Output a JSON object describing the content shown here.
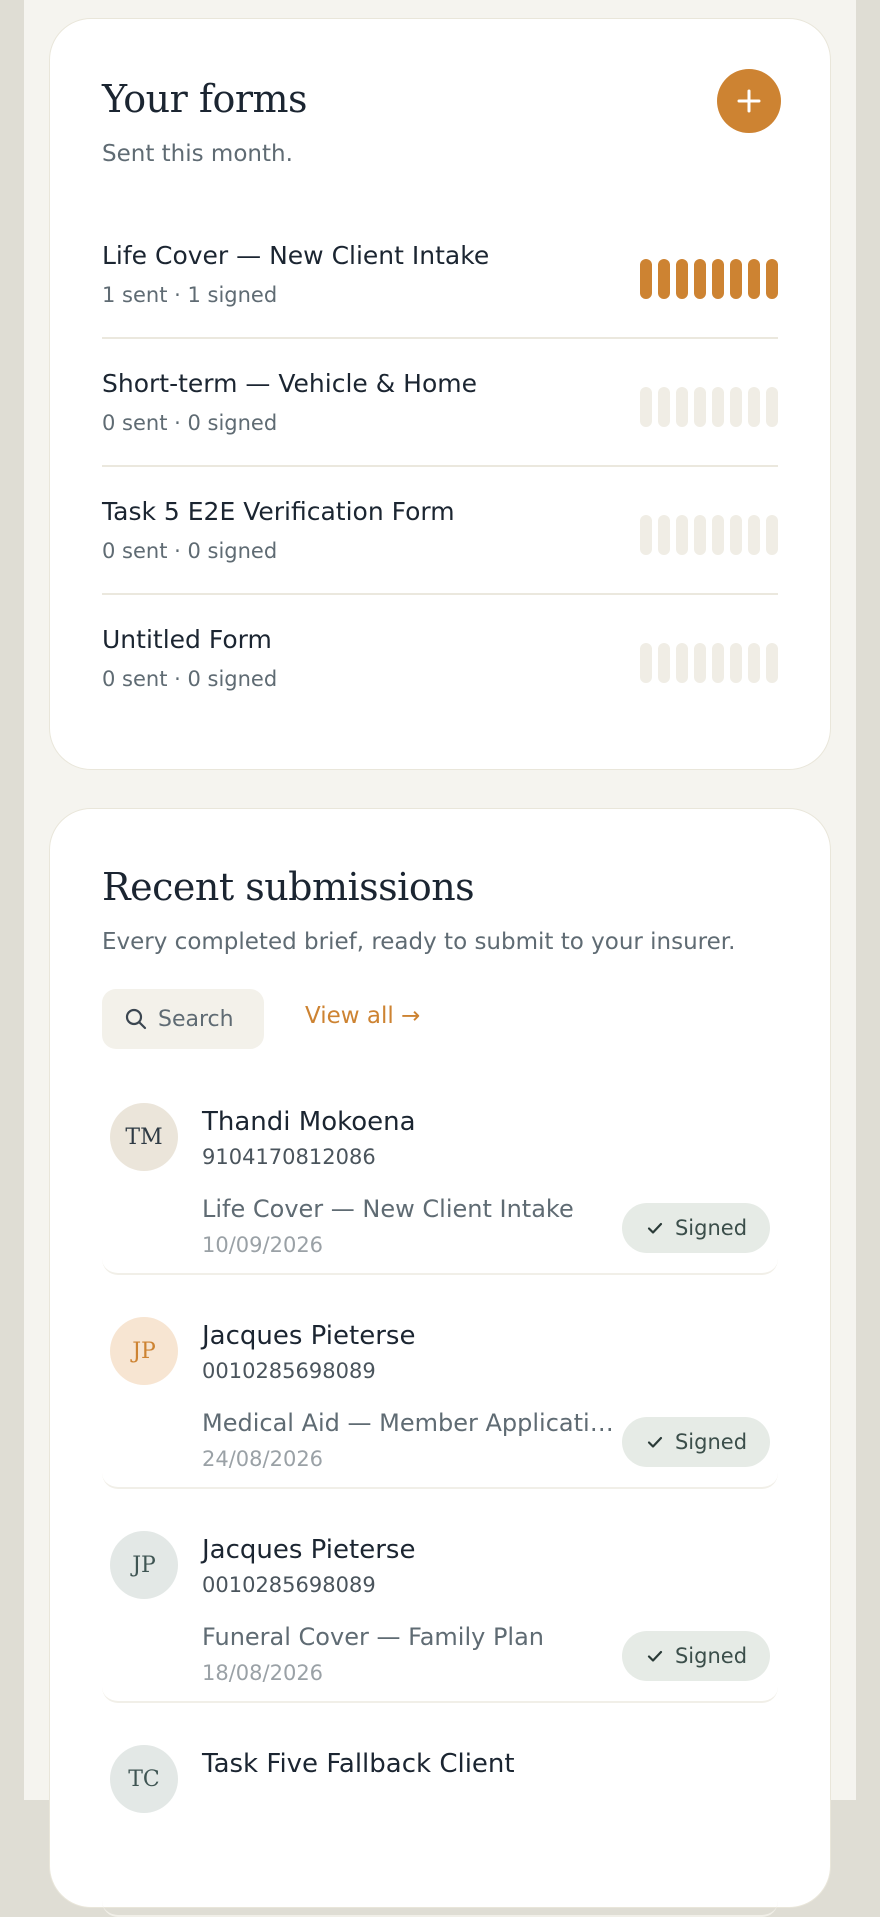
{
  "forms": {
    "title": "Your forms",
    "subtitle": "Sent this month.",
    "add_icon": "plus-icon",
    "items": [
      {
        "name": "Life Cover — New Client Intake",
        "stats": "1 sent · 1 signed",
        "progress_filled_bars": 8,
        "progress_total_bars": 8
      },
      {
        "name": "Short-term — Vehicle & Home",
        "stats": "0 sent · 0 signed",
        "progress_filled_bars": 0,
        "progress_total_bars": 8
      },
      {
        "name": "Task 5 E2E Verification Form",
        "stats": "0 sent · 0 signed",
        "progress_filled_bars": 0,
        "progress_total_bars": 8
      },
      {
        "name": "Untitled Form",
        "stats": "0 sent · 0 signed",
        "progress_filled_bars": 0,
        "progress_total_bars": 8
      }
    ]
  },
  "submissions": {
    "title": "Recent submissions",
    "subtitle": "Every completed brief, ready to submit to your insurer.",
    "search_label": "Search",
    "view_all": "View all →",
    "items": [
      {
        "initials": "TM",
        "name": "Thandi Mokoena",
        "id_number": "9104170812086",
        "form": "Life Cover — New Client Intake",
        "date": "10/09/2026",
        "status": "Signed",
        "avatar_bg": "#ebe5da",
        "avatar_fg": "#2e3a44"
      },
      {
        "initials": "JP",
        "name": "Jacques Pieterse",
        "id_number": "0010285698089",
        "form": "Medical Aid — Member Application",
        "date": "24/08/2026",
        "status": "Signed",
        "avatar_bg": "#f7e5d2",
        "avatar_fg": "#cd8332"
      },
      {
        "initials": "JP",
        "name": "Jacques Pieterse",
        "id_number": "0010285698089",
        "form": "Funeral Cover — Family Plan",
        "date": "18/08/2026",
        "status": "Signed",
        "avatar_bg": "#e3e8e6",
        "avatar_fg": "#3f5553"
      },
      {
        "initials": "TC",
        "name": "Task Five Fallback Client",
        "id_number": "",
        "form": "",
        "date": "",
        "status": "",
        "avatar_bg": "#e3e8e6",
        "avatar_fg": "#3f5553"
      }
    ]
  },
  "colors": {
    "accent": "#cd8332",
    "bar_empty": "#f0ede5",
    "badge_bg": "#e6ebe6"
  }
}
